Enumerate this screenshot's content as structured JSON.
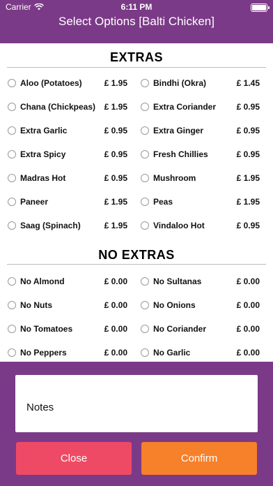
{
  "status_bar": {
    "carrier": "Carrier",
    "time": "6:11 PM"
  },
  "title": "Select Options [Balti Chicken]",
  "extras": {
    "heading": "EXTRAS",
    "items": [
      {
        "name": "Aloo (Potatoes)",
        "price": "£ 1.95"
      },
      {
        "name": "Bindhi (Okra)",
        "price": "£ 1.45"
      },
      {
        "name": "Chana (Chickpeas)",
        "price": "£ 1.95"
      },
      {
        "name": "Extra Coriander",
        "price": "£ 0.95"
      },
      {
        "name": "Extra Garlic",
        "price": "£ 0.95"
      },
      {
        "name": "Extra Ginger",
        "price": "£ 0.95"
      },
      {
        "name": "Extra Spicy",
        "price": "£ 0.95"
      },
      {
        "name": "Fresh Chillies",
        "price": "£ 0.95"
      },
      {
        "name": "Madras Hot",
        "price": "£ 0.95"
      },
      {
        "name": "Mushroom",
        "price": "£ 1.95"
      },
      {
        "name": "Paneer",
        "price": "£ 1.95"
      },
      {
        "name": "Peas",
        "price": "£ 1.95"
      },
      {
        "name": "Saag (Spinach)",
        "price": "£ 1.95"
      },
      {
        "name": "Vindaloo Hot",
        "price": "£ 0.95"
      }
    ]
  },
  "no_extras": {
    "heading": "NO EXTRAS",
    "items": [
      {
        "name": "No Almond",
        "price": "£ 0.00"
      },
      {
        "name": "No Sultanas",
        "price": "£ 0.00"
      },
      {
        "name": "No Nuts",
        "price": "£ 0.00"
      },
      {
        "name": "No Onions",
        "price": "£ 0.00"
      },
      {
        "name": "No Tomatoes",
        "price": "£ 0.00"
      },
      {
        "name": "No Coriander",
        "price": "£ 0.00"
      },
      {
        "name": "No Peppers",
        "price": "£ 0.00"
      },
      {
        "name": "No Garlic",
        "price": "£ 0.00"
      }
    ]
  },
  "notes": {
    "placeholder": "Notes"
  },
  "buttons": {
    "close": "Close",
    "confirm": "Confirm"
  },
  "colors": {
    "background": "#7b3a87",
    "close": "#ef4a65",
    "confirm": "#f7802a"
  }
}
